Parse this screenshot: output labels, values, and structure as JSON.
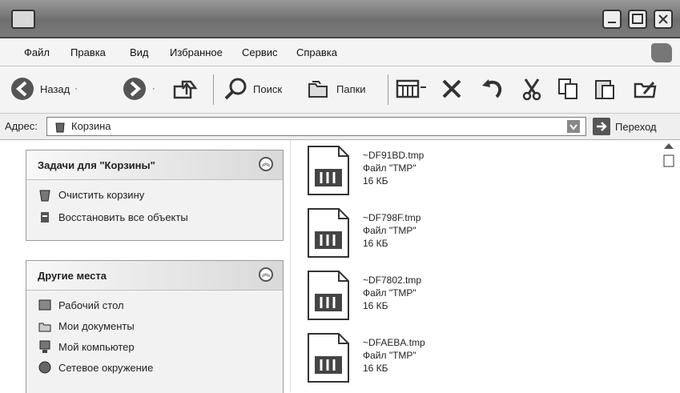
{
  "menu": {
    "items": [
      {
        "label": "Файл"
      },
      {
        "label": "Правка"
      },
      {
        "label": "Вид"
      },
      {
        "label": "Избранное"
      },
      {
        "label": "Сервис"
      },
      {
        "label": "Справка"
      }
    ]
  },
  "toolbar": {
    "back_label": "Назад",
    "search_label": "Поиск",
    "folders_label": "Папки"
  },
  "address": {
    "label": "Адрес:",
    "value": "Корзина",
    "go_label": "Переход"
  },
  "tasks_panel": {
    "title": "Задачи для \"Корзины\"",
    "items": [
      {
        "label": "Очистить корзину",
        "icon": "empty-recycle-icon"
      },
      {
        "label": "Восстановить все объекты",
        "icon": "restore-icon"
      }
    ]
  },
  "places_panel": {
    "title": "Другие места",
    "items": [
      {
        "label": "Рабочий стол",
        "icon": "desktop-icon"
      },
      {
        "label": "Мои документы",
        "icon": "documents-icon"
      },
      {
        "label": "Мой компьютер",
        "icon": "computer-icon"
      },
      {
        "label": "Сетевое окружение",
        "icon": "network-icon"
      }
    ]
  },
  "files": [
    {
      "name": "~DF91BD.tmp",
      "type": "Файл \"TMP\"",
      "size": "16 КБ"
    },
    {
      "name": "~DF798F.tmp",
      "type": "Файл \"TMP\"",
      "size": "16 КБ"
    },
    {
      "name": "~DF7802.tmp",
      "type": "Файл \"TMP\"",
      "size": "16 КБ"
    },
    {
      "name": "~DFAEBA.tmp",
      "type": "Файл \"TMP\"",
      "size": "16 КБ"
    }
  ],
  "colors": {
    "titlebar": "#7b7b7b",
    "panel": "#f2f2f2"
  }
}
